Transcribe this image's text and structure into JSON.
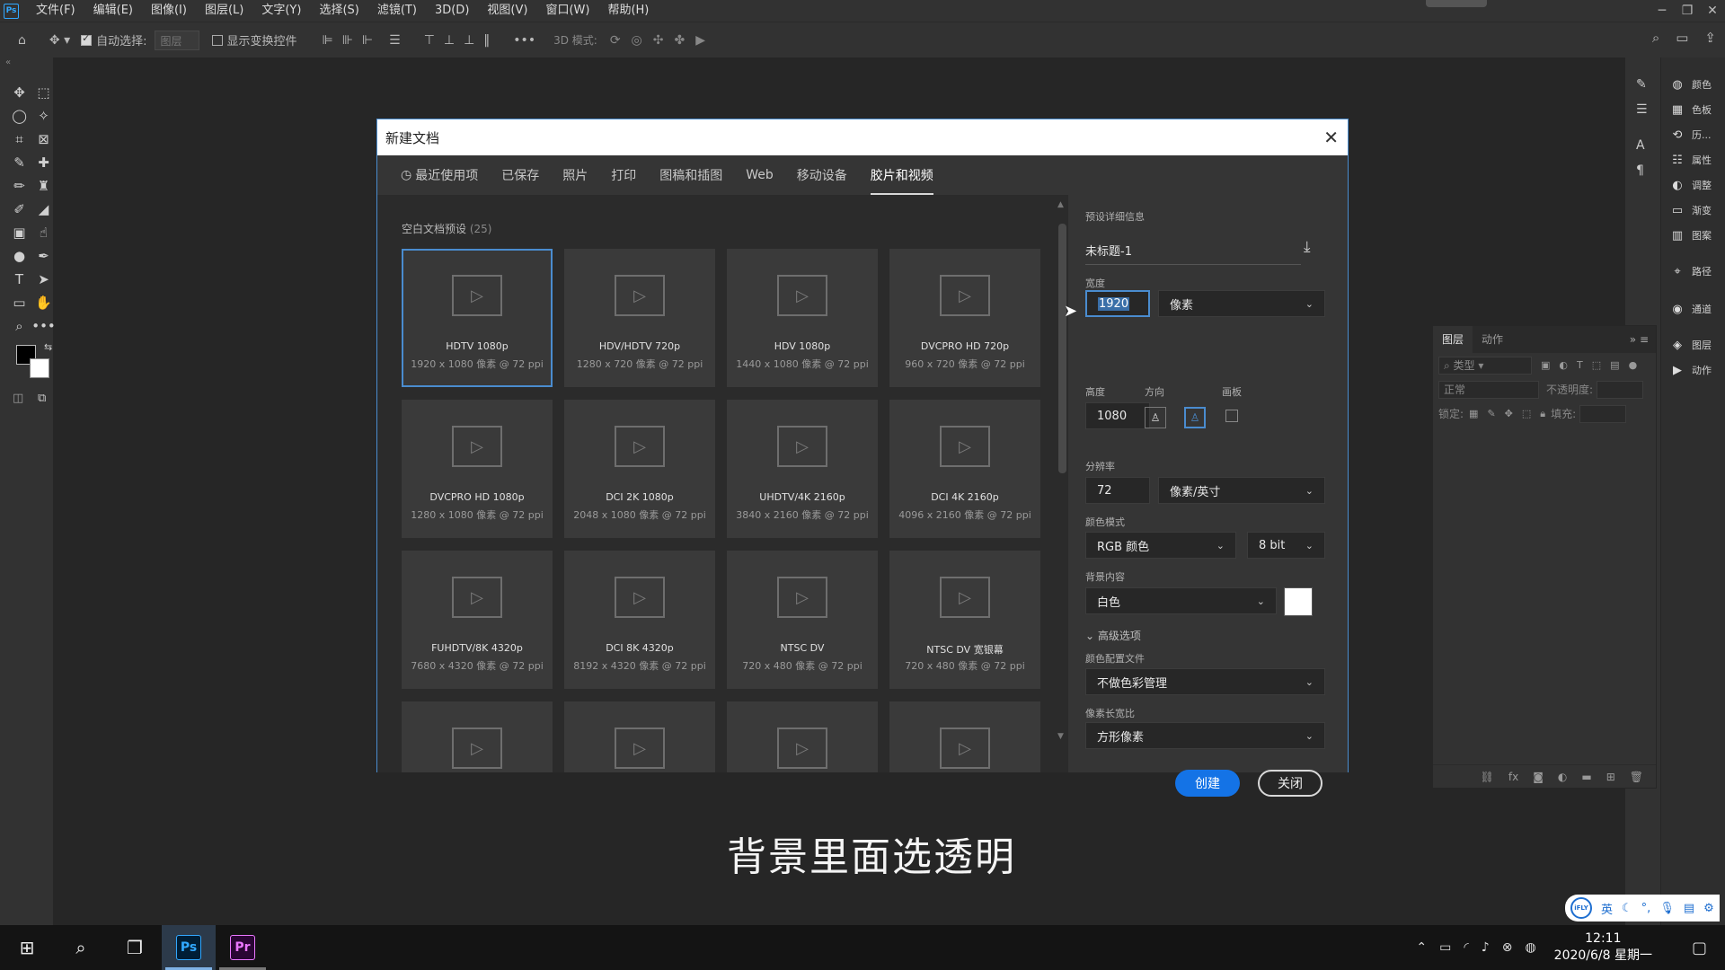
{
  "menubar": {
    "logo": "Ps",
    "items": [
      "文件(F)",
      "编辑(E)",
      "图像(I)",
      "图层(L)",
      "文字(Y)",
      "选择(S)",
      "滤镜(T)",
      "3D(D)",
      "视图(V)",
      "窗口(W)",
      "帮助(H)"
    ],
    "win_min": "─",
    "win_restore": "❐",
    "win_close": "✕"
  },
  "options": {
    "auto_select": "自动选择:",
    "layer_select": "图层",
    "show_transform": "显示变换控件",
    "three_d_mode": "3D 模式:"
  },
  "dialog": {
    "title": "新建文档",
    "tabs": [
      "最近使用项",
      "已保存",
      "照片",
      "打印",
      "图稿和插图",
      "Web",
      "移动设备",
      "胶片和视频"
    ],
    "active_tab": 7,
    "presets_label": "空白文档预设",
    "presets_count": "(25)",
    "presets": [
      {
        "name": "HDTV 1080p",
        "size": "1920 x 1080 像素 @ 72 ppi"
      },
      {
        "name": "HDV/HDTV 720p",
        "size": "1280 x 720 像素 @ 72 ppi"
      },
      {
        "name": "HDV 1080p",
        "size": "1440 x 1080 像素 @ 72 ppi"
      },
      {
        "name": "DVCPRO HD 720p",
        "size": "960 x 720 像素 @ 72 ppi"
      },
      {
        "name": "DVCPRO HD 1080p",
        "size": "1280 x 1080 像素 @ 72 ppi"
      },
      {
        "name": "DCI 2K 1080p",
        "size": "2048 x 1080 像素 @ 72 ppi"
      },
      {
        "name": "UHDTV/4K 2160p",
        "size": "3840 x 2160 像素 @ 72 ppi"
      },
      {
        "name": "DCI 4K 2160p",
        "size": "4096 x 2160 像素 @ 72 ppi"
      },
      {
        "name": "FUHDTV/8K 4320p",
        "size": "7680 x 4320 像素 @ 72 ppi"
      },
      {
        "name": "DCI 8K 4320p",
        "size": "8192 x 4320 像素 @ 72 ppi"
      },
      {
        "name": "NTSC DV",
        "size": "720 x 480 像素 @ 72 ppi"
      },
      {
        "name": "NTSC DV 宽银幕",
        "size": "720 x 480 像素 @ 72 ppi"
      },
      {
        "name": "",
        "size": ""
      },
      {
        "name": "",
        "size": ""
      },
      {
        "name": "",
        "size": ""
      },
      {
        "name": "",
        "size": ""
      }
    ],
    "details": {
      "header": "预设详细信息",
      "doc_name": "未标题-1",
      "width_label": "宽度",
      "width_value": "1920",
      "width_unit": "像素",
      "height_label": "高度",
      "height_value": "1080",
      "orientation_label": "方向",
      "artboard_label": "画板",
      "resolution_label": "分辨率",
      "resolution_value": "72",
      "resolution_unit": "像素/英寸",
      "color_mode_label": "颜色模式",
      "color_mode": "RGB 颜色",
      "bit_depth": "8 bit",
      "bg_label": "背景内容",
      "bg_value": "白色",
      "advanced": "高级选项",
      "profile_label": "颜色配置文件",
      "profile_value": "不做色彩管理",
      "pixel_ratio_label": "像素长宽比",
      "pixel_ratio_value": "方形像素",
      "create": "创建",
      "close": "关闭"
    }
  },
  "right_panels": [
    {
      "icon": "◍",
      "label": "颜色"
    },
    {
      "icon": "▦",
      "label": "色板"
    },
    {
      "icon": "⟲",
      "label": "历..."
    },
    {
      "icon": "☷",
      "label": "属性"
    },
    {
      "icon": "◐",
      "label": "调整"
    },
    {
      "icon": "▭",
      "label": "渐变"
    },
    {
      "icon": "▥",
      "label": "图案"
    },
    {
      "icon": "⌖",
      "label": "路径"
    },
    {
      "icon": "◉",
      "label": "通道"
    },
    {
      "icon": "◈",
      "label": "图层"
    },
    {
      "icon": "▶",
      "label": "动作"
    }
  ],
  "layers_panel": {
    "tab_layers": "图层",
    "tab_actions": "动作",
    "filter": "类型",
    "blend": "正常",
    "opacity": "不透明度:",
    "lock": "锁定:",
    "fill": "填充:"
  },
  "subtitle": "背景里面选透明",
  "ime": {
    "logo": "iFLY",
    "lang": "英"
  },
  "taskbar": {
    "ps": "Ps",
    "pr": "Pr",
    "time": "12:11",
    "date": "2020/6/8 星期一"
  }
}
